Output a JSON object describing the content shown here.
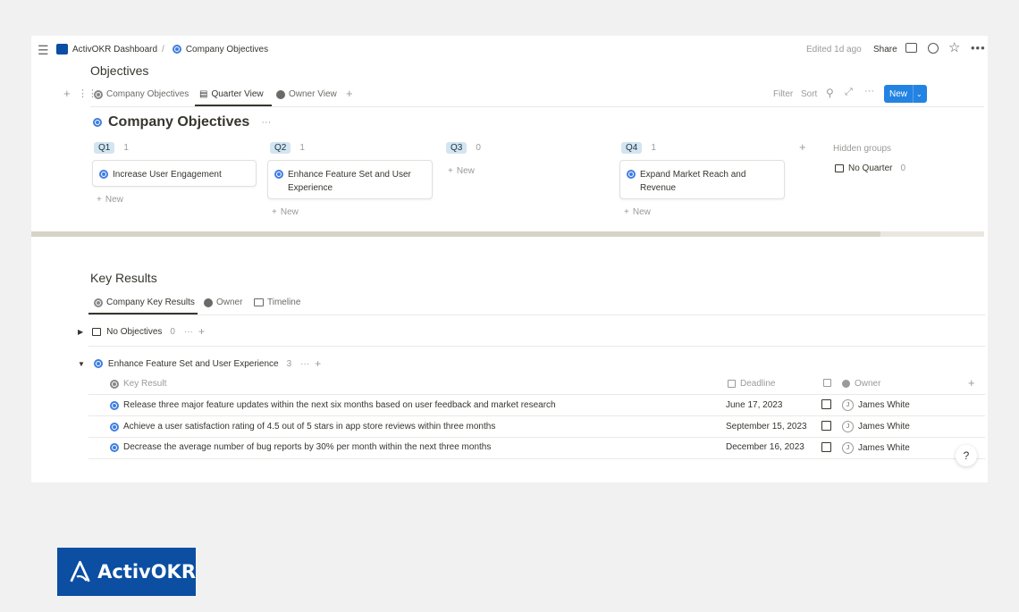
{
  "topbar": {
    "breadcrumb_root": "ActivOKR Dashboard",
    "breadcrumb_sep": "/",
    "breadcrumb_page": "Company Objectives",
    "edited": "Edited 1d ago",
    "share": "Share"
  },
  "objectives": {
    "title": "Objectives",
    "tabs": [
      "Company Objectives",
      "Quarter View",
      "Owner View"
    ],
    "filter": "Filter",
    "sort": "Sort",
    "new_label": "New",
    "board_title": "Company Objectives",
    "groups": [
      {
        "name": "Q1",
        "count": "1",
        "cards": [
          "Increase User Engagement"
        ],
        "new": "New"
      },
      {
        "name": "Q2",
        "count": "1",
        "cards": [
          "Enhance Feature Set and User Experience"
        ],
        "new": "New"
      },
      {
        "name": "Q3",
        "count": "0",
        "cards": [],
        "new": "New"
      },
      {
        "name": "Q4",
        "count": "1",
        "cards": [
          "Expand Market Reach and Revenue"
        ],
        "new": "New"
      }
    ],
    "hidden_groups_label": "Hidden groups",
    "no_quarter": "No Quarter",
    "no_quarter_count": "0"
  },
  "key_results": {
    "title": "Key Results",
    "tabs": [
      "Company Key Results",
      "Owner",
      "Timeline"
    ],
    "group_none": {
      "label": "No Objectives",
      "count": "0"
    },
    "group_open": {
      "label": "Enhance Feature Set and User Experience",
      "count": "3"
    },
    "columns": {
      "key_result": "Key Result",
      "deadline": "Deadline",
      "owner": "Owner"
    },
    "rows": [
      {
        "name": "Release three major feature updates within the next six months based on user feedback and market research",
        "deadline": "June 17, 2023",
        "owner": "James White"
      },
      {
        "name": "Achieve a user satisfaction rating of 4.5 out of 5 stars in app store reviews within three months",
        "deadline": "September 15, 2023",
        "owner": "James White"
      },
      {
        "name": "Decrease the average number of bug reports by 30% per month within the next three months",
        "deadline": "December 16, 2023",
        "owner": "James White"
      }
    ]
  },
  "help": "?",
  "brand": {
    "name": "ActivOKR",
    "color": "#0b4ea2"
  },
  "colors": {
    "accent": "#2383e2",
    "target": "#3f7ee0"
  }
}
